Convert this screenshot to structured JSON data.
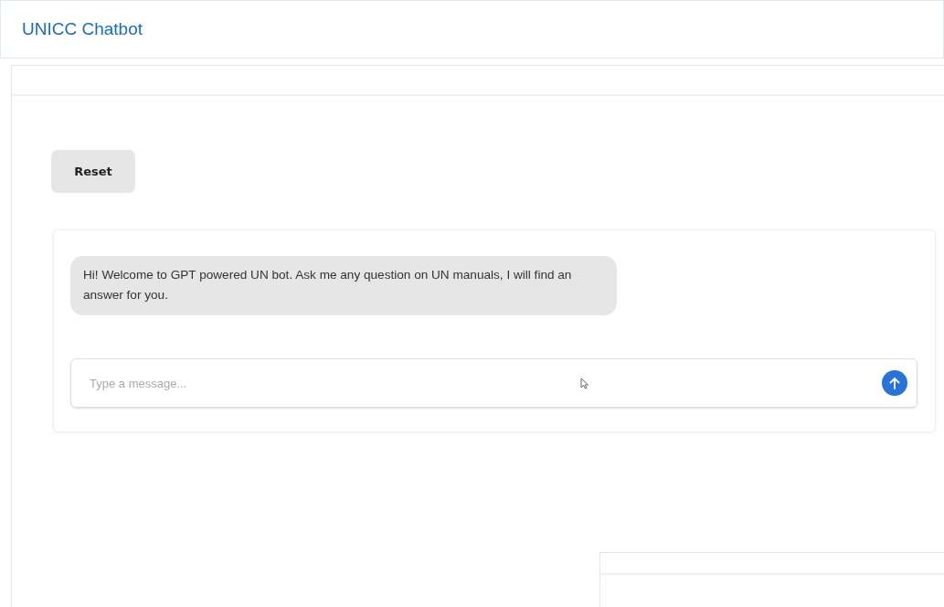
{
  "header": {
    "title": "UNICC Chatbot"
  },
  "reset_button": {
    "label": "Reset"
  },
  "messages": [
    {
      "text": "Hi! Welcome to GPT powered UN bot. Ask me any question on UN manuals, I will find an answer for you."
    }
  ],
  "composer": {
    "placeholder": "Type a message..."
  }
}
